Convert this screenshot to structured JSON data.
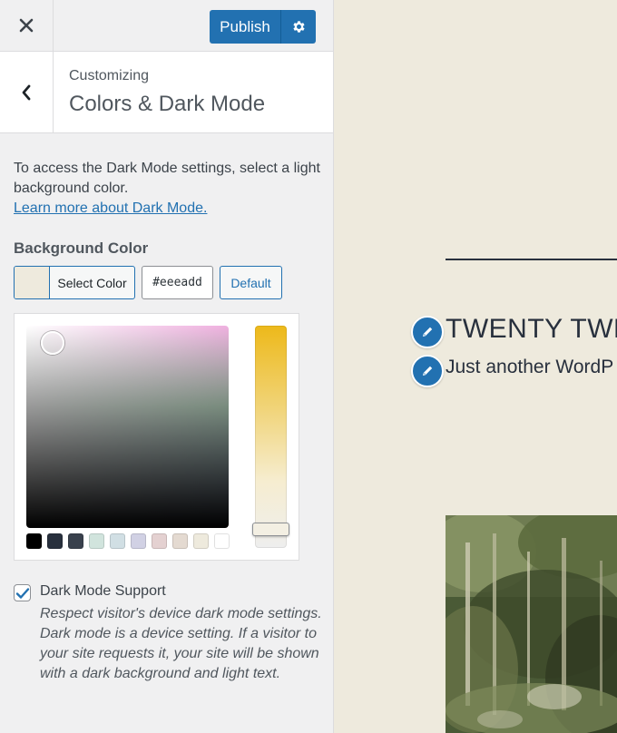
{
  "header": {
    "publish_label": "Publish"
  },
  "section": {
    "breadcrumb": "Customizing",
    "title": "Colors & Dark Mode"
  },
  "intro": {
    "text": "To access the Dark Mode settings, select a light background color.",
    "link": "Learn more about Dark Mode."
  },
  "background_color": {
    "label": "Background Color",
    "select_label": "Select Color",
    "hex_value": "#eeeadd",
    "default_label": "Default",
    "current_color": "#eeeadd",
    "palette": [
      "#000000",
      "#28303d",
      "#39414d",
      "#d1e4dd",
      "#d1dfe4",
      "#d1d1e4",
      "#e4d1d1",
      "#e4dad1",
      "#eeeadd",
      "#ffffff"
    ]
  },
  "dark_mode": {
    "checked": true,
    "label": "Dark Mode Support",
    "line1": "Respect visitor's device dark mode settings.",
    "line2": "Dark mode is a device setting. If a visitor to your site requests it, your site will be shown with a dark background and light text."
  },
  "preview": {
    "site_title": "TWENTY TWE",
    "tagline": "Just another WordP"
  },
  "colors": {
    "accent": "#2271b1",
    "preview_text": "#28303d"
  },
  "icons": {
    "close": "close-icon",
    "gear": "gear-icon",
    "back": "chevron-left-icon",
    "edit": "pencil-icon",
    "check": "checkmark-icon"
  }
}
